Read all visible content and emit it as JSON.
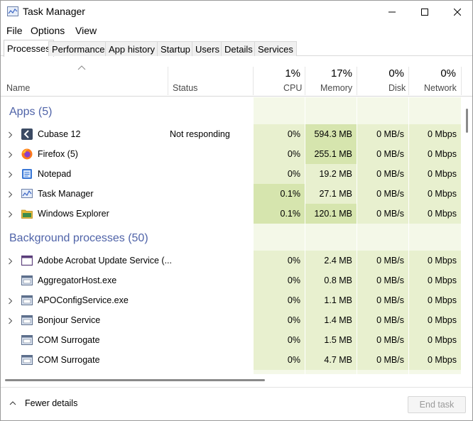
{
  "window": {
    "title": "Task Manager",
    "icon": "task-manager-icon"
  },
  "menu": {
    "items": [
      "File",
      "Options",
      "View"
    ]
  },
  "tabs": {
    "items": [
      "Processes",
      "Performance",
      "App history",
      "Startup",
      "Users",
      "Details",
      "Services"
    ],
    "active": "Processes"
  },
  "header": {
    "name": "Name",
    "status": "Status",
    "cpu": {
      "pct": "1%",
      "label": "CPU"
    },
    "memory": {
      "pct": "17%",
      "label": "Memory"
    },
    "disk": {
      "pct": "0%",
      "label": "Disk"
    },
    "network": {
      "pct": "0%",
      "label": "Network"
    }
  },
  "groups": {
    "apps": {
      "label": "Apps (5)",
      "rows": [
        {
          "name": "Cubase 12",
          "status": "Not responding",
          "cpu": "0%",
          "memory": "594.3 MB",
          "disk": "0 MB/s",
          "network": "0 Mbps",
          "icon": "cubase-icon"
        },
        {
          "name": "Firefox (5)",
          "status": "",
          "cpu": "0%",
          "memory": "255.1 MB",
          "disk": "0 MB/s",
          "network": "0 Mbps",
          "icon": "firefox-icon"
        },
        {
          "name": "Notepad",
          "status": "",
          "cpu": "0%",
          "memory": "19.2 MB",
          "disk": "0 MB/s",
          "network": "0 Mbps",
          "icon": "notepad-icon"
        },
        {
          "name": "Task Manager",
          "status": "",
          "cpu": "0.1%",
          "memory": "27.1 MB",
          "disk": "0 MB/s",
          "network": "0 Mbps",
          "icon": "task-manager-icon"
        },
        {
          "name": "Windows Explorer",
          "status": "",
          "cpu": "0.1%",
          "memory": "120.1 MB",
          "disk": "0 MB/s",
          "network": "0 Mbps",
          "icon": "folder-icon"
        }
      ]
    },
    "background": {
      "label": "Background processes (50)",
      "rows": [
        {
          "name": "Adobe Acrobat Update Service (...",
          "status": "",
          "cpu": "0%",
          "memory": "2.4 MB",
          "disk": "0 MB/s",
          "network": "0 Mbps",
          "icon": "window-icon"
        },
        {
          "name": "AggregatorHost.exe",
          "status": "",
          "cpu": "0%",
          "memory": "0.8 MB",
          "disk": "0 MB/s",
          "network": "0 Mbps",
          "icon": "service-icon"
        },
        {
          "name": "APOConfigService.exe",
          "status": "",
          "cpu": "0%",
          "memory": "1.1 MB",
          "disk": "0 MB/s",
          "network": "0 Mbps",
          "icon": "service-icon"
        },
        {
          "name": "Bonjour Service",
          "status": "",
          "cpu": "0%",
          "memory": "1.4 MB",
          "disk": "0 MB/s",
          "network": "0 Mbps",
          "icon": "service-icon"
        },
        {
          "name": "COM Surrogate",
          "status": "",
          "cpu": "0%",
          "memory": "1.5 MB",
          "disk": "0 MB/s",
          "network": "0 Mbps",
          "icon": "service-icon"
        },
        {
          "name": "COM Surrogate",
          "status": "",
          "cpu": "0%",
          "memory": "4.7 MB",
          "disk": "0 MB/s",
          "network": "0 Mbps",
          "icon": "service-icon"
        }
      ]
    }
  },
  "footer": {
    "fewer_details": "Fewer details",
    "end_task": "End task"
  },
  "colors": {
    "cpu_bg": "#f4f8e8",
    "heat_light": "#e8f0cf",
    "heat_mid": "#d6e5ae",
    "group_label": "#4f63a8"
  }
}
